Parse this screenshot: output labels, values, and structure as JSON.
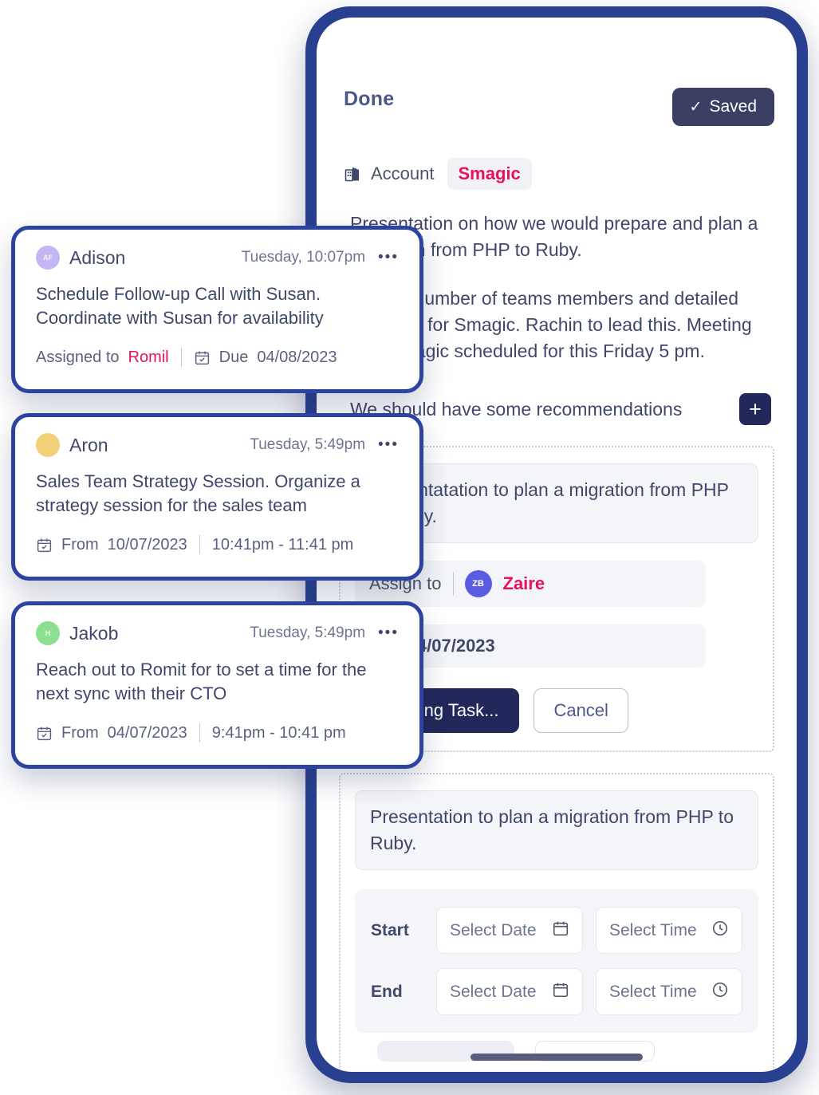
{
  "colors": {
    "frame": "#28408f",
    "accent_pink": "#e8115b",
    "dark_navy": "#22295a",
    "text": "#3f486b",
    "muted": "#6e7591"
  },
  "phone": {
    "header": {
      "title": "Done",
      "saved_button": "Saved",
      "saved_check_icon": "check-icon"
    },
    "account": {
      "icon": "building-icon",
      "label": "Account",
      "badge": "Smagic"
    },
    "description": {
      "paragraph_1": "Presentation on how we would prepare and plan a migration from PHP to Ruby.",
      "paragraph_2": "Include number of teams members and detailed timelines for Smagic.  Rachin to lead this.  Meeting with Smagic scheduled for this Friday 5 pm."
    },
    "recommendations": {
      "text": "We should have some recommendations",
      "add_button_icon": "plus-icon",
      "add_button_label": "+"
    },
    "task_form": {
      "description_value": "Presentatation to plan a migration from PHP to Ruby.",
      "assign_label": "Assign to",
      "assignee": {
        "initials": "ZB",
        "name": "Zaire",
        "avatar_color": "#5b5ce2"
      },
      "due_date": "Due 04/07/2023",
      "primary_button": "Creating Task...",
      "cancel_button": "Cancel"
    },
    "schedule_form": {
      "description_value": "Presentation to plan a migration from PHP to Ruby.",
      "rows": [
        {
          "label": "Start",
          "date_placeholder": "Select Date",
          "date_icon": "calendar-icon",
          "time_placeholder": "Select Time",
          "time_icon": "clock-icon"
        },
        {
          "label": "End",
          "date_placeholder": "Select Date",
          "date_icon": "calendar-icon",
          "time_placeholder": "Select Time",
          "time_icon": "clock-icon"
        }
      ]
    }
  },
  "task_cards": [
    {
      "avatar_initials": "AF",
      "avatar_color": "#c3b6f2",
      "name": "Adison",
      "time": "Tuesday, 10:07pm",
      "menu_icon": "more-horizontal-icon",
      "body": "Schedule Follow-up Call with Susan. Coordinate with Susan for availability",
      "meta_kind": "assigned",
      "assigned_label": "Assigned to",
      "assignee": "Romil",
      "date_icon": "calendar-check-icon",
      "due_label": "Due",
      "due_date": "04/08/2023"
    },
    {
      "avatar_initials": "",
      "avatar_color": "#f2d077",
      "name": "Aron",
      "time": "Tuesday, 5:49pm",
      "menu_icon": "more-horizontal-icon",
      "body": "Sales Team Strategy Session. Organize a strategy session for the sales team",
      "meta_kind": "range",
      "date_icon": "calendar-check-icon",
      "from_label": "From",
      "from_date": "10/07/2023",
      "time_range": "10:41pm - 11:41 pm"
    },
    {
      "avatar_initials": "H",
      "avatar_color": "#8bdf8f",
      "name": "Jakob",
      "time": "Tuesday, 5:49pm",
      "menu_icon": "more-horizontal-icon",
      "body": "Reach out to Romit for to set a time for the next sync with their CTO",
      "meta_kind": "range",
      "date_icon": "calendar-check-icon",
      "from_label": "From",
      "from_date": "04/07/2023",
      "time_range": "9:41pm - 10:41 pm"
    }
  ]
}
